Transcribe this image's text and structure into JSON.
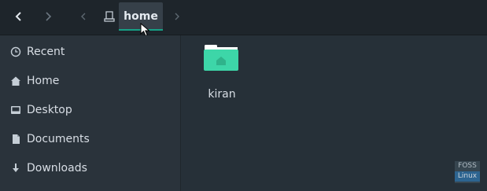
{
  "toolbar": {
    "back_icon": "chevron-left-icon",
    "forward_icon": "chevron-right-icon",
    "path_back_icon": "chevron-left-icon",
    "path_forward_icon": "chevron-right-icon",
    "root_icon": "drive-icon",
    "current_path": "home"
  },
  "sidebar": {
    "items": [
      {
        "label": "Recent",
        "icon": "clock-icon"
      },
      {
        "label": "Home",
        "icon": "home-icon"
      },
      {
        "label": "Desktop",
        "icon": "desktop-icon"
      },
      {
        "label": "Documents",
        "icon": "document-icon"
      },
      {
        "label": "Downloads",
        "icon": "download-icon"
      }
    ]
  },
  "content": {
    "items": [
      {
        "name": "kiran",
        "type": "folder",
        "icon": "home-folder-icon"
      }
    ]
  },
  "watermark": {
    "top": "FOSS",
    "bottom": "Linux"
  },
  "colors": {
    "accent": "#16a085",
    "folder": "#3dd6a8",
    "header_bg": "#1e252b",
    "sidebar_bg": "#2a333b",
    "content_bg": "#263038"
  }
}
